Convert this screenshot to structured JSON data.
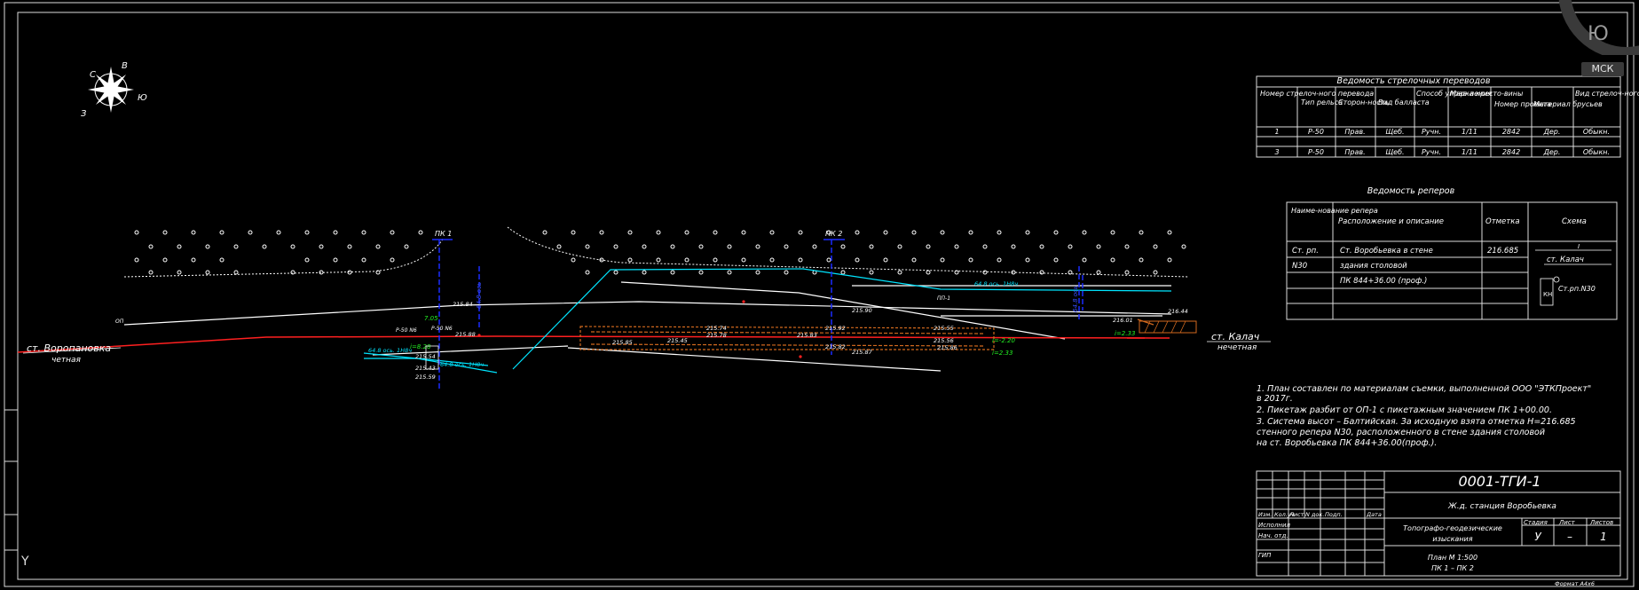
{
  "viewcube": {
    "letter": "Ю",
    "wcs_label": "МСК"
  },
  "compass": {
    "labels": [
      "С",
      "В",
      "Ю",
      "З"
    ]
  },
  "switch_table": {
    "title": "Ведомость стрелочных переводов",
    "headers": [
      "Номер стрелоч-ного перевода",
      "Тип рельса",
      "Сторон-ность",
      "Вид балласта",
      "Способ управ-ления",
      "Марка кресто-вины",
      "Номер проекта",
      "Материал брусьев",
      "Вид стрелоч-ного перевода"
    ],
    "rows": [
      [
        "1",
        "Р-50",
        "Прав.",
        "Щеб.",
        "Ручн.",
        "1/11",
        "2842",
        "Дер.",
        "Обыкн."
      ],
      [
        "3",
        "Р-50",
        "Прав.",
        "Щеб.",
        "Ручн.",
        "1/11",
        "2842",
        "Дер.",
        "Обыкн."
      ]
    ]
  },
  "benchmark_table": {
    "title": "Ведомость реперов",
    "headers": [
      "Наиме-нование репера",
      "Расположение и описание",
      "Отметка",
      "Схема"
    ],
    "rows": [
      [
        "Ст. рп.",
        "Ст. Воробьевка в стене",
        "216.685"
      ],
      [
        "N30",
        "здания столовой",
        ""
      ],
      [
        "",
        "ПК 844+36.00 (проф.)",
        ""
      ]
    ],
    "scheme": {
      "station": "ст. Калач",
      "benchmark": "Ст.рп.N30",
      "box": "КН",
      "mark": "I"
    }
  },
  "notes": [
    "1. План составлен по материалам съемки, выполненной ООО \"ЭТКПроект\"",
    "   в 2017г.",
    "2. Пикетаж разбит от ОП-1 с пикетажным значением ПК 1+00.00.",
    "3. Система высот – Балтийская. За исходную взята отметка Н=216.685",
    "   стенного репера N30, расположенного в стене здания столовой",
    "   на ст. Воробьевка ПК 844+36.00(проф.)."
  ],
  "title_block": {
    "code": "0001-ТГИ-1",
    "project": "Ж.д. станция Воробьевка",
    "revision_headers": [
      "Изм.",
      "Кол.уч",
      "Лист",
      "N док.",
      "Подп.",
      "Дата"
    ],
    "roles": [
      "Исполнил",
      "Нач. отд.",
      "",
      "ГИП"
    ],
    "work_type": [
      "Топографо-геодезические",
      "изыскания"
    ],
    "sheet_headers": [
      "Стадия",
      "Лист",
      "Листов"
    ],
    "sheet_values": [
      "У",
      "–",
      "1"
    ],
    "drawing": [
      "План М 1:500",
      "ПК 1 – ПК 2"
    ],
    "format": "Формат А4х6"
  },
  "plan": {
    "station_left": [
      "ст. Воропановка",
      "четная"
    ],
    "station_right": [
      "ст. Калач",
      "нечетная"
    ],
    "pickets": [
      "ПК 1",
      "ПК 2"
    ],
    "elevations": [
      "215.84",
      "215.88",
      "215.59",
      "215.54",
      "215.43",
      "215.74",
      "215.78",
      "215.83",
      "215.45",
      "215.85",
      "215.92",
      "215.90",
      "215.82",
      "215.87",
      "215.55",
      "215.56",
      "215.86",
      "216.44",
      "216.01"
    ],
    "green_labels": [
      "7.05",
      "i=8.28",
      "i=-2.20",
      "i=2.33",
      "i=2.33"
    ],
    "cyan_labels": [
      "64.8 ось. 1Н8ч",
      "64.8 ось. 1Н8ч",
      "64.8 ось. 1Н8ч"
    ],
    "blue_labels": [
      "64.8 ось",
      "64.8 ось"
    ],
    "side_labels": [
      "Р-50 N6",
      "Р-50 N6",
      "ПП-1",
      "ОП"
    ],
    "edge_axis_label": "Y"
  },
  "colors": {
    "background": "#000000",
    "lines": "#ffffff",
    "red_track": "#ff2020",
    "cyan": "#00e5ff",
    "blue": "#1a2cff",
    "green": "#22ee22",
    "orange": "#d2691e"
  }
}
